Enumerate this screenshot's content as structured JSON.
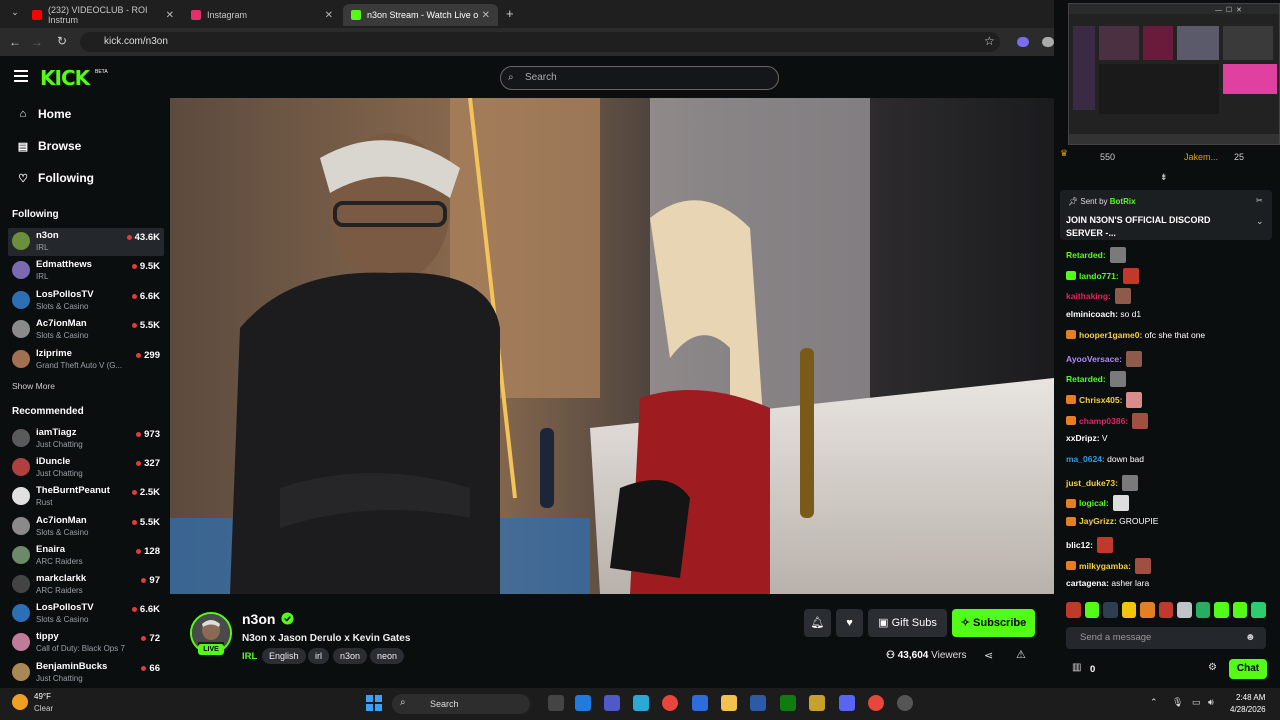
{
  "browser": {
    "tabs": [
      {
        "label": "(232) VIDEOCLUB - ROI Instrum",
        "color": "#ff0000"
      },
      {
        "label": "Instagram",
        "color": "#e1306c"
      },
      {
        "label": "n3on Stream - Watch Live o",
        "color": "#53fc18"
      }
    ],
    "url": "kick.com/n3on"
  },
  "kick": {
    "logo": "KICK",
    "logo_badge": "BETA",
    "search_placeholder": "Search",
    "nav": {
      "home": "Home",
      "browse": "Browse",
      "following": "Following"
    },
    "following_title": "Following",
    "following": [
      {
        "name": "n3on",
        "category": "IRL",
        "viewers": "43.6K",
        "color": "#6b8f3a"
      },
      {
        "name": "Edmatthews",
        "category": "IRL",
        "viewers": "9.5K",
        "color": "#7a6bb0"
      },
      {
        "name": "LosPollosTV",
        "category": "Slots & Casino",
        "viewers": "6.6K",
        "color": "#2c6fb5"
      },
      {
        "name": "Ac7ionMan",
        "category": "Slots & Casino",
        "viewers": "5.5K",
        "color": "#8a8a8a"
      },
      {
        "name": "lziprime",
        "category": "Grand Theft Auto V (G...",
        "viewers": "299",
        "color": "#a07050"
      }
    ],
    "show_more": "Show More",
    "recommended_title": "Recommended",
    "recommended": [
      {
        "name": "iamTiagz",
        "category": "Just Chatting",
        "viewers": "973",
        "color": "#5a5a5a"
      },
      {
        "name": "iDuncle",
        "category": "Just Chatting",
        "viewers": "327",
        "color": "#b04040"
      },
      {
        "name": "TheBurntPeanut",
        "category": "Rust",
        "viewers": "2.5K",
        "color": "#e0e0e0"
      },
      {
        "name": "Ac7ionMan",
        "category": "Slots & Casino",
        "viewers": "5.5K",
        "color": "#8a8a8a"
      },
      {
        "name": "Enaira",
        "category": "ARC Raiders",
        "viewers": "128",
        "color": "#6a8a6a"
      },
      {
        "name": "markclarkk",
        "category": "ARC Raiders",
        "viewers": "97",
        "color": "#444"
      },
      {
        "name": "LosPollosTV",
        "category": "Slots & Casino",
        "viewers": "6.6K",
        "color": "#2c6fb5"
      },
      {
        "name": "tippy",
        "category": "Call of Duty: Black Ops 7",
        "viewers": "72",
        "color": "#c07a9a"
      },
      {
        "name": "BenjaminBucks",
        "category": "Just Chatting",
        "viewers": "66",
        "color": "#aa8855"
      }
    ]
  },
  "stream": {
    "streamer": "n3on",
    "live": "LIVE",
    "title": "N3on x Jason Derulo x Kevin Gates",
    "category": "IRL",
    "tags": [
      "English",
      "irl",
      "n3on",
      "neon"
    ],
    "gift_subs": "Gift Subs",
    "subscribe": "Subscribe",
    "viewers": "43,604",
    "viewers_label": "Viewers"
  },
  "chat": {
    "top_left_count": "550",
    "top_right_user": "Jakem...",
    "top_right_count": "25",
    "pinned_sent_by": "Sent by",
    "pinned_bot": "BotRix",
    "pinned_message": "JOIN N3ON'S OFFICIAL DISCORD SERVER -...",
    "messages": [
      {
        "user": "Retarded:",
        "text": "",
        "color": "#53fc18",
        "emote": "#7a7a7a"
      },
      {
        "user": "lando771:",
        "text": "",
        "color": "#53fc18",
        "emote": "#c0392b",
        "badge": "#53fc18"
      },
      {
        "user": "kaithaking:",
        "text": "",
        "color": "#e0245e",
        "emote": "#8e5a4a"
      },
      {
        "user": "elminicoach:",
        "text": "so d1",
        "color": "#ffffff"
      },
      {
        "user": "hooper1game0:",
        "text": "ofc she that one",
        "color": "#f4d03f",
        "badge": "#e67e22"
      },
      {
        "user": "AyooVersace:",
        "text": "",
        "color": "#b388ff",
        "emote": "#8e5a4a"
      },
      {
        "user": "Retarded:",
        "text": "",
        "color": "#53fc18",
        "emote": "#7a7a7a"
      },
      {
        "user": "Chrisx405:",
        "text": "",
        "color": "#f4d03f",
        "emote": "#d98c8c",
        "badge": "#e67e22"
      },
      {
        "user": "champ0386:",
        "text": "",
        "color": "#e0245e",
        "emote": "#a05040",
        "badge": "#e67e22"
      },
      {
        "user": "xxDripz:",
        "text": "V",
        "color": "#ffffff"
      },
      {
        "user": "ma_0624:",
        "text": "down bad",
        "color": "#3498db"
      },
      {
        "user": "just_duke73:",
        "text": "",
        "color": "#f4d03f",
        "emote": "#7a7a7a"
      },
      {
        "user": "logical:",
        "text": "",
        "color": "#53fc18",
        "emote": "#dddddd",
        "badge": "#e67e22"
      },
      {
        "user": "JayGrizz:",
        "text": "GROUPIE",
        "color": "#f4d03f",
        "badge": "#e67e22"
      },
      {
        "user": "blic12:",
        "text": "",
        "color": "#ffffff",
        "emote": "#c0392b"
      },
      {
        "user": "milkygamba:",
        "text": "",
        "color": "#f4d03f",
        "emote": "#a05040",
        "badge": "#e67e22"
      },
      {
        "user": "cartagena:",
        "text": "asher lara",
        "color": "#ffffff"
      }
    ],
    "input_placeholder": "Send a message",
    "points": "0",
    "chat_button": "Chat"
  },
  "taskbar": {
    "weather_temp": "49°F",
    "weather_desc": "Clear",
    "search": "Search",
    "time": "2:48 AM",
    "date": "4/28/2026"
  },
  "colors": {
    "accent": "#53fc18",
    "bg": "#0b0e0f"
  }
}
